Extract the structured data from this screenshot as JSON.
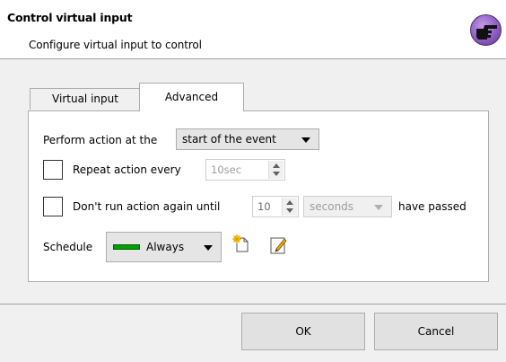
{
  "header": {
    "title": "Control virtual input",
    "subtitle": "Configure virtual input to control",
    "icon": "pointing-hand-icon"
  },
  "tabs": [
    {
      "label": "Virtual input",
      "active": false
    },
    {
      "label": "Advanced",
      "active": true
    }
  ],
  "advanced": {
    "perform_label": "Perform action at the",
    "perform_value": "start of the event",
    "repeat": {
      "checked": false,
      "label": "Repeat action every",
      "value": "10sec"
    },
    "dont_run": {
      "checked": false,
      "label": "Don't run action again until",
      "value": "10",
      "unit": "seconds",
      "suffix": "have passed"
    },
    "schedule": {
      "label": "Schedule",
      "value": "Always",
      "color": "#00a000",
      "new_icon": "new-schedule-icon",
      "edit_icon": "edit-schedule-icon"
    }
  },
  "footer": {
    "ok_label": "OK",
    "cancel_label": "Cancel"
  }
}
